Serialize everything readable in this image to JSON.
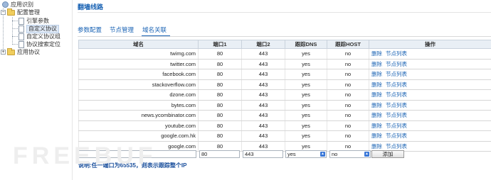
{
  "sidebar": {
    "root": "应用识别",
    "items": [
      {
        "label": "配置管理",
        "toggle": "−"
      },
      {
        "label": "引擎参数"
      },
      {
        "label": "自定义协议"
      },
      {
        "label": "自定义协议组"
      },
      {
        "label": "协议搜索定位"
      },
      {
        "label": "应用协议",
        "toggle": "+"
      }
    ],
    "selected": "自定义协议"
  },
  "header": {
    "title": "翻墙线路"
  },
  "tabs": [
    {
      "label": "参数配置"
    },
    {
      "label": "节点管理"
    },
    {
      "label": "域名关联",
      "active": true
    }
  ],
  "table": {
    "headers": [
      "域名",
      "端口1",
      "端口2",
      "跟踪DNS",
      "跟踪HOST",
      "操作"
    ],
    "rows": [
      {
        "domain": "twimg.com",
        "port1": "80",
        "port2": "443",
        "dns": "yes",
        "host": "no"
      },
      {
        "domain": "twitter.com",
        "port1": "80",
        "port2": "443",
        "dns": "yes",
        "host": "no"
      },
      {
        "domain": "facebook.com",
        "port1": "80",
        "port2": "443",
        "dns": "yes",
        "host": "no"
      },
      {
        "domain": "stackoverflow.com",
        "port1": "80",
        "port2": "443",
        "dns": "yes",
        "host": "no"
      },
      {
        "domain": "dzone.com",
        "port1": "80",
        "port2": "443",
        "dns": "yes",
        "host": "no"
      },
      {
        "domain": "bytes.com",
        "port1": "80",
        "port2": "443",
        "dns": "yes",
        "host": "no"
      },
      {
        "domain": "news.ycombinator.com",
        "port1": "80",
        "port2": "443",
        "dns": "yes",
        "host": "no"
      },
      {
        "domain": "youtube.com",
        "port1": "80",
        "port2": "443",
        "dns": "yes",
        "host": "no"
      },
      {
        "domain": "google.com.hk",
        "port1": "80",
        "port2": "443",
        "dns": "yes",
        "host": "no"
      },
      {
        "domain": "google.com",
        "port1": "80",
        "port2": "443",
        "dns": "yes",
        "host": "no"
      }
    ],
    "op_delete": "删除",
    "op_nodes": "节点列表"
  },
  "add_row": {
    "domain_value": "",
    "port1_value": "80",
    "port2_value": "443",
    "dns_value": "yes",
    "host_value": "no",
    "add_label": "添加"
  },
  "note": "说明:任一端口为65535，则表示跟踪整个IP",
  "watermark": "FREEBUF",
  "colors": {
    "accent": "#1a63b4",
    "header_bg": "#e9eff5"
  }
}
